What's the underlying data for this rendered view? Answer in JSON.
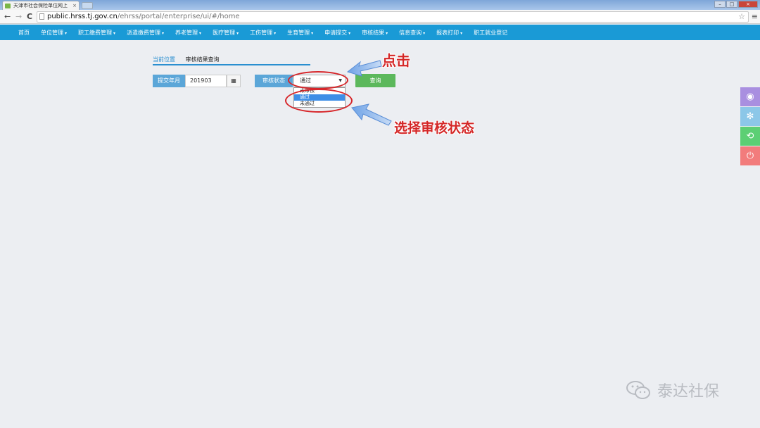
{
  "browser": {
    "tab_title": "天津市社会保险单位网上",
    "tab_close": "×",
    "url_host": "public.hrss.tj.gov.cn",
    "url_path": "/ehrss/portal/enterprise/ui/#/home",
    "nav_back": "←",
    "nav_forward": "→",
    "nav_reload": "C",
    "star": "☆",
    "menu": "≡",
    "win_minimize": "–",
    "win_maximize": "□",
    "win_close": "×"
  },
  "nav": {
    "items": [
      {
        "label": "首页",
        "caret": ""
      },
      {
        "label": "单位管理",
        "caret": "▾"
      },
      {
        "label": "职工缴费管理",
        "caret": "▾"
      },
      {
        "label": "派遣缴费管理",
        "caret": "▾"
      },
      {
        "label": "养老管理",
        "caret": "▾"
      },
      {
        "label": "医疗管理",
        "caret": "▾"
      },
      {
        "label": "工伤管理",
        "caret": "▾"
      },
      {
        "label": "生育管理",
        "caret": "▾"
      },
      {
        "label": "申请提交",
        "caret": "▾"
      },
      {
        "label": "审核结果",
        "caret": "▾"
      },
      {
        "label": "信息查询",
        "caret": "▾"
      },
      {
        "label": "报表打印",
        "caret": "▾"
      },
      {
        "label": "职工就业登记",
        "caret": ""
      }
    ]
  },
  "breadcrumb": {
    "current_label": "当前位置",
    "page": "审核结果查询"
  },
  "form": {
    "submit_month_label": "提交年月",
    "submit_month_value": "201903",
    "calendar_icon": "▦",
    "status_label": "审核状态",
    "status_selected": "通过",
    "status_arrow": "▼",
    "status_options": [
      "未审核",
      "通过",
      "未通过"
    ],
    "status_highlighted_index": 1,
    "query_button": "查询"
  },
  "annotations": {
    "click_text": "点击",
    "select_text": "选择审核状态"
  },
  "side_toolbar": [
    {
      "icon": "eye-icon",
      "glyph": "◉",
      "color": "#a98fe0"
    },
    {
      "icon": "tree-icon",
      "glyph": "✻",
      "color": "#8cc7e8"
    },
    {
      "icon": "refresh-icon",
      "glyph": "⟲",
      "color": "#5ccf74"
    },
    {
      "icon": "power-icon",
      "glyph": "⏻",
      "color": "#f27c7c"
    }
  ],
  "watermark": {
    "text": "泰达社保"
  }
}
